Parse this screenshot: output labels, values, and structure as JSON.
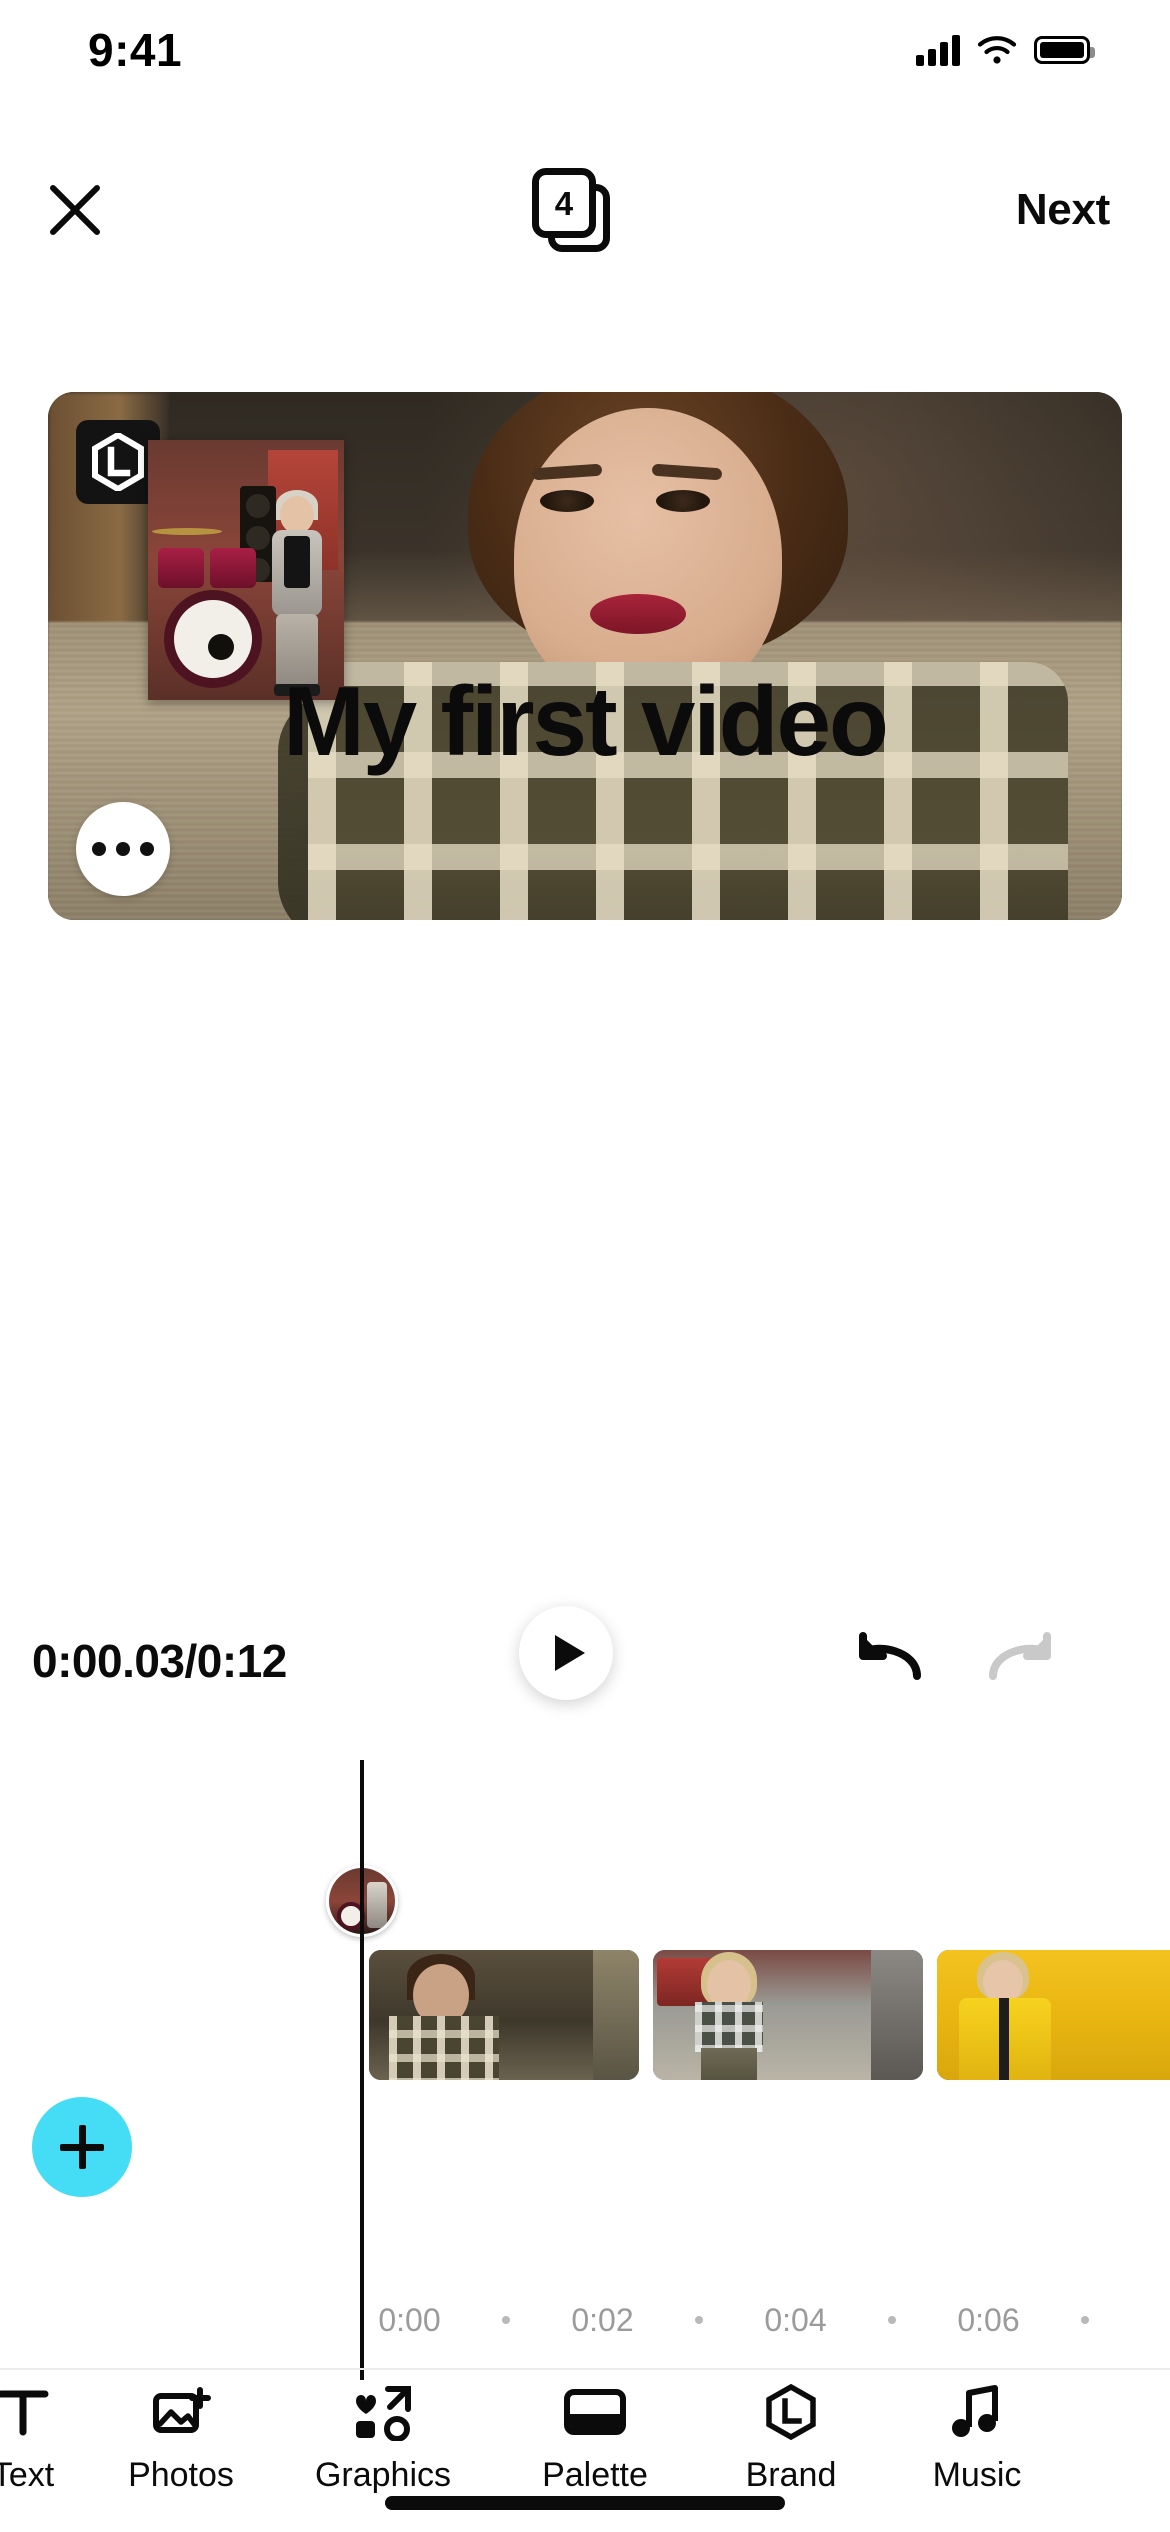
{
  "status_bar": {
    "time": "9:41",
    "signal_icon": "cellular-signal-icon",
    "wifi_icon": "wifi-icon",
    "battery_icon": "battery-full-icon"
  },
  "nav": {
    "close_icon": "close-x-icon",
    "scenes_icon": "scenes-layers-icon",
    "scene_count": "4",
    "next_label": "Next"
  },
  "preview": {
    "brand_logo_icon": "brand-hexagon-l-icon",
    "overlay_text": "My first video",
    "more_options_icon": "more-options-ellipsis-icon",
    "sticker_name": "photo-sticker-drummer"
  },
  "controls": {
    "timecode": "0:00.03/0:12",
    "current_time": "0:00.03",
    "total_time": "0:12",
    "play_icon": "play-icon",
    "undo_icon": "undo-icon",
    "redo_icon": "redo-icon",
    "undo_enabled": "true",
    "redo_enabled": "false"
  },
  "timeline": {
    "add_clip_icon": "plus-icon",
    "add_clip_color": "#45DCF5",
    "playhead_position": "0:00.03",
    "overlay_chip_name": "overlay-clip-thumbnail",
    "clips": [
      {
        "name": "clip-1",
        "label": ""
      },
      {
        "name": "clip-2",
        "label": ""
      },
      {
        "name": "clip-3",
        "label": ""
      }
    ],
    "ruler_marks": [
      "0:00",
      "0:02",
      "0:04",
      "0:06"
    ]
  },
  "toolbar": {
    "items": [
      {
        "label": "Text",
        "icon": "text-t-icon"
      },
      {
        "label": "Photos",
        "icon": "photos-add-icon"
      },
      {
        "label": "Graphics",
        "icon": "graphics-shapes-icon"
      },
      {
        "label": "Palette",
        "icon": "palette-icon"
      },
      {
        "label": "Brand",
        "icon": "brand-hexagon-icon"
      },
      {
        "label": "Music",
        "icon": "music-note-icon"
      }
    ]
  },
  "home_indicator": {
    "name": "home-indicator"
  }
}
